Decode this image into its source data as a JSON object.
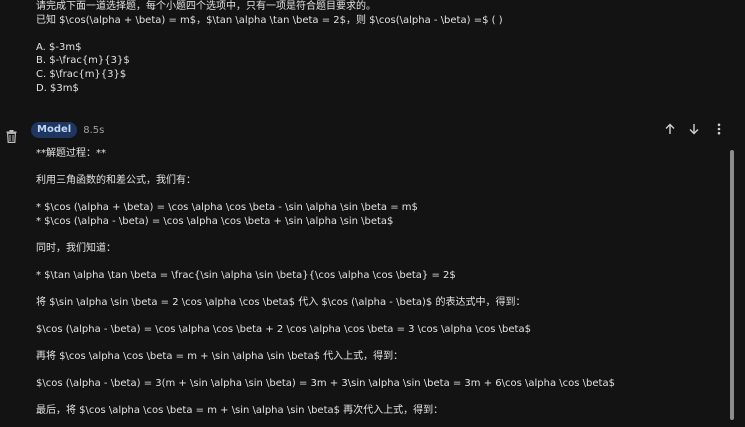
{
  "prompt": {
    "lines": [
      "请完成下面一道选择题，每个小题四个选项中，只有一项是符合题目要求的。",
      "已知 $\\cos(\\alpha + \\beta) = m$，$\\tan \\alpha \\tan \\beta = 2$，则 $\\cos(\\alpha - \\beta) =$ ( )",
      "",
      "A. $-3m$",
      "B. $-\\frac{m}{3}$",
      "C. $\\frac{m}{3}$",
      "D. $3m$"
    ]
  },
  "model_header": {
    "badge": "Model",
    "time": "8.5s"
  },
  "icons": {
    "delete": "trash-icon",
    "up": "arrow-up-icon",
    "down": "arrow-down-icon",
    "more": "more-vert-icon"
  },
  "response": {
    "lines": [
      "**解题过程：**",
      "",
      "利用三角函数的和差公式，我们有：",
      "",
      "* $\\cos (\\alpha + \\beta) = \\cos \\alpha \\cos \\beta - \\sin \\alpha \\sin \\beta = m$",
      "* $\\cos (\\alpha - \\beta) = \\cos \\alpha \\cos \\beta + \\sin \\alpha \\sin \\beta$",
      "",
      "同时，我们知道：",
      "",
      "* $\\tan \\alpha \\tan \\beta = \\frac{\\sin \\alpha \\sin \\beta}{\\cos \\alpha \\cos \\beta} = 2$",
      "",
      "将 $\\sin \\alpha \\sin \\beta = 2 \\cos \\alpha \\cos \\beta$ 代入 $\\cos (\\alpha - \\beta)$ 的表达式中，得到：",
      "",
      "$\\cos (\\alpha - \\beta) = \\cos \\alpha \\cos \\beta + 2 \\cos \\alpha \\cos \\beta = 3 \\cos \\alpha \\cos \\beta$",
      "",
      "再将 $\\cos \\alpha \\cos \\beta = m + \\sin \\alpha \\sin \\beta$ 代入上式，得到：",
      "",
      "$\\cos (\\alpha - \\beta) = 3(m + \\sin \\alpha \\sin \\beta) = 3m + 3\\sin \\alpha \\sin \\beta = 3m + 6\\cos \\alpha \\cos \\beta$",
      "",
      "最后，将 $\\cos \\alpha \\cos \\beta = m + \\sin \\alpha \\sin \\beta$ 再次代入上式，得到："
    ]
  }
}
